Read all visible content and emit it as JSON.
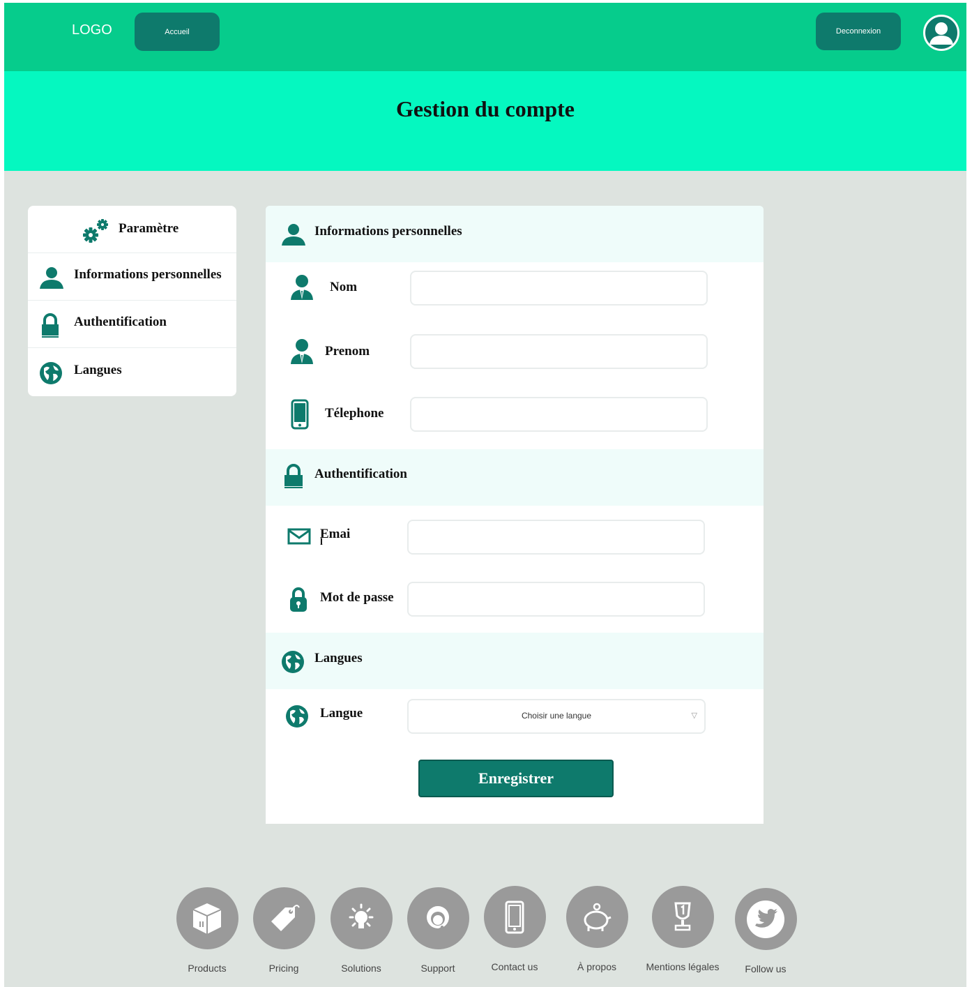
{
  "header": {
    "logo": "LOGO",
    "home_button": "Accueil",
    "logout_button": "Deconnexion"
  },
  "hero": {
    "title": "Gestion du compte"
  },
  "sidebar": {
    "title": "Paramètre",
    "items": [
      {
        "label": "Informations personnelles",
        "icon": "user-icon"
      },
      {
        "label": "Authentification",
        "icon": "lock-icon"
      },
      {
        "label": "Langues",
        "icon": "globe-icon"
      }
    ]
  },
  "form": {
    "personal": {
      "title": "Informations personnelles",
      "nom_label": "Nom",
      "prenom_label": "Prenom",
      "telephone_label": "Télephone",
      "nom_value": "",
      "prenom_value": "",
      "telephone_value": ""
    },
    "auth": {
      "title": "Authentification",
      "email_label": "Emai",
      "email_label_overflow": "l",
      "password_label": "Mot de passe",
      "email_value": "",
      "password_value": ""
    },
    "languages": {
      "title": "Langues",
      "langue_label": "Langue",
      "select_placeholder": "Choisir une langue",
      "select_arrow": "▽"
    },
    "save_button": "Enregistrer"
  },
  "footer": {
    "items": [
      {
        "label": "Products",
        "icon": "box-icon"
      },
      {
        "label": "Pricing",
        "icon": "tag-icon"
      },
      {
        "label": "Solutions",
        "icon": "lightbulb-icon"
      },
      {
        "label": "Support",
        "icon": "headset-icon"
      },
      {
        "label": "Contact us",
        "icon": "phone-icon"
      },
      {
        "label": "À propos",
        "icon": "piggy-bank-icon"
      },
      {
        "label": "Mentions légales",
        "icon": "trophy-icon"
      },
      {
        "label": "Follow us",
        "icon": "twitter-icon"
      }
    ]
  },
  "colors": {
    "topbar": "#06cc8c",
    "hero": "#05f8c0",
    "accent": "#0e7a6c",
    "background": "#dde3df",
    "section_bg": "#effcfa",
    "footer_icon": "#9a9a9a"
  }
}
